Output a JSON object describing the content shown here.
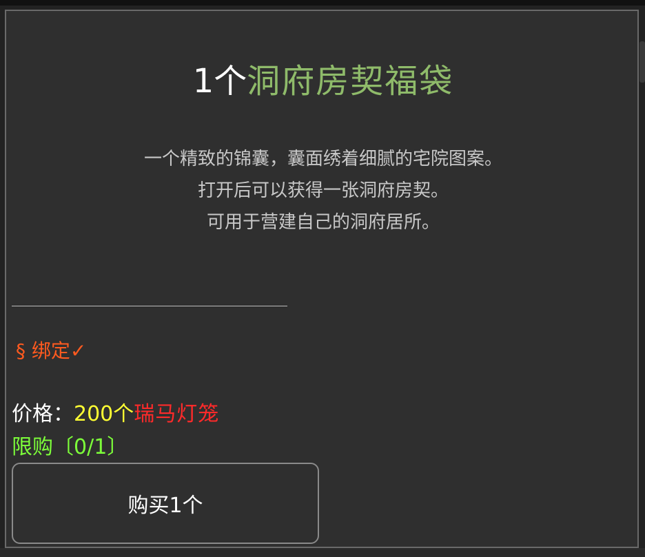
{
  "dialog": {
    "title_qty": "1个",
    "title_name": "洞府房契福袋",
    "description": [
      "一个精致的锦囊，囊面绣着细腻的宅院图案。",
      "打开后可以获得一张洞府房契。",
      "可用于营建自己的洞府居所。"
    ],
    "bind_text": "§ 绑定✓",
    "price": {
      "label": "价格：",
      "amount": "200个",
      "currency": "瑞马灯笼"
    },
    "limit_text": "限购〔0/1〕",
    "buy_button_label": "购买1个"
  },
  "colors": {
    "title_name": "#8fbb6a",
    "bind": "#ff5a1f",
    "price_amount": "#ffff33",
    "price_currency": "#ff2a2a",
    "limit": "#7dff3a",
    "dialog_bg": "#2f2f2f"
  }
}
